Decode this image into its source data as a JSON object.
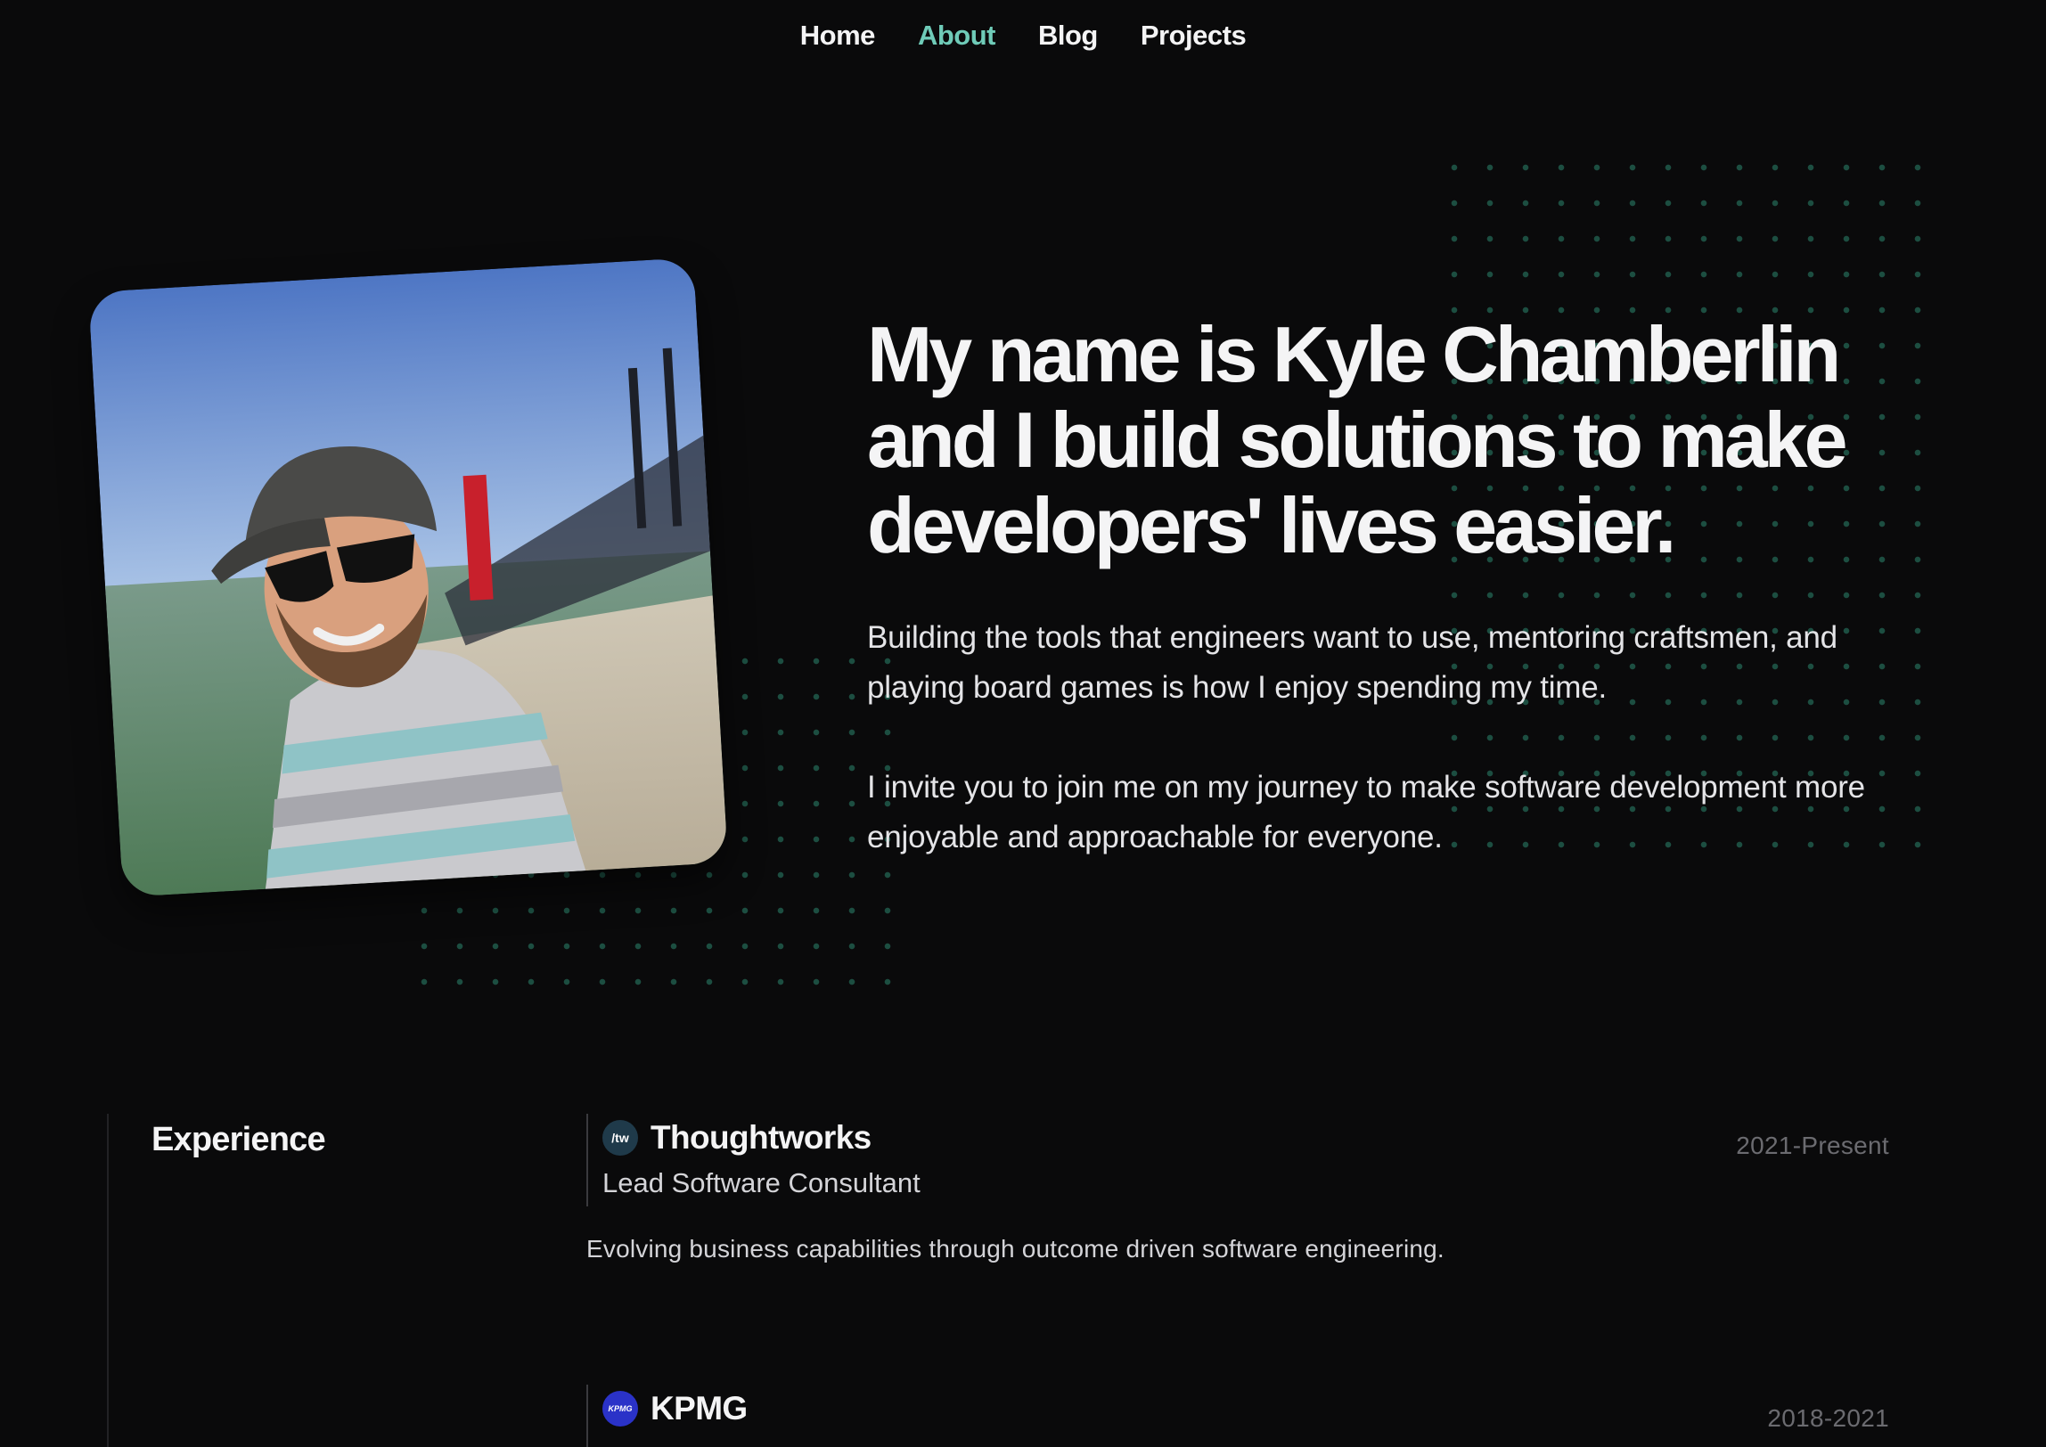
{
  "nav": {
    "items": [
      {
        "label": "Home",
        "active": false
      },
      {
        "label": "About",
        "active": true
      },
      {
        "label": "Blog",
        "active": false
      },
      {
        "label": "Projects",
        "active": false
      }
    ],
    "active_color": "#6fcbb8"
  },
  "hero": {
    "headline": "My name is Kyle Chamberlin and I build solutions to make developers' lives easier.",
    "paragraph_1": "Building the tools that engineers want to use, mentoring craftsmen, and playing board games is how I enjoy spending my time.",
    "paragraph_2": "I invite you to join me on my journey to make software development more enjoyable and approachable for everyone."
  },
  "experience": {
    "title": "Experience",
    "jobs": [
      {
        "company": "Thoughtworks",
        "logo_text": "/tw",
        "role": "Lead Software Consultant",
        "dates": "2021-Present",
        "description": "Evolving business capabilities through outcome driven software engineering."
      },
      {
        "company": "KPMG",
        "logo_text": "KPMG",
        "role": "",
        "dates": "2018-2021",
        "description": ""
      }
    ]
  },
  "colors": {
    "background": "#0a0a0b",
    "accent": "#6fcbb8",
    "dot": "#1f5a4a"
  }
}
